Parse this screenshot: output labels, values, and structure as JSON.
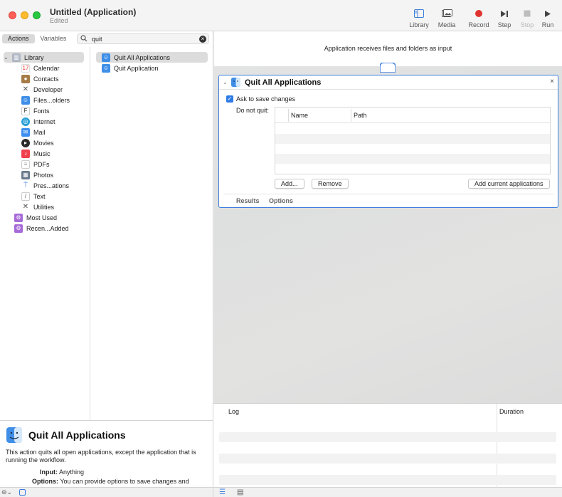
{
  "window": {
    "title": "Untitled (Application)",
    "subtitle": "Edited"
  },
  "toolbar": {
    "library_label": "Library",
    "media_label": "Media",
    "record_label": "Record",
    "step_label": "Step",
    "stop_label": "Stop",
    "run_label": "Run",
    "record_color": "#e0332e"
  },
  "sidebar": {
    "tabs": [
      "Actions",
      "Variables"
    ],
    "search": {
      "value": "quit"
    },
    "library": [
      {
        "label": "Library",
        "icon": "library-icon"
      },
      {
        "label": "Calendar",
        "icon": "calendar-icon"
      },
      {
        "label": "Contacts",
        "icon": "contacts-icon"
      },
      {
        "label": "Developer",
        "icon": "developer-icon"
      },
      {
        "label": "Files...olders",
        "icon": "finder-icon"
      },
      {
        "label": "Fonts",
        "icon": "fonts-icon"
      },
      {
        "label": "Internet",
        "icon": "internet-icon"
      },
      {
        "label": "Mail",
        "icon": "mail-icon"
      },
      {
        "label": "Movies",
        "icon": "movies-icon"
      },
      {
        "label": "Music",
        "icon": "music-icon"
      },
      {
        "label": "PDFs",
        "icon": "pdf-icon"
      },
      {
        "label": "Photos",
        "icon": "photos-icon"
      },
      {
        "label": "Pres...ations",
        "icon": "presentations-icon"
      },
      {
        "label": "Text",
        "icon": "text-icon"
      },
      {
        "label": "Utilities",
        "icon": "utilities-icon"
      },
      {
        "label": "Most Used",
        "icon": "smart-folder-icon"
      },
      {
        "label": "Recen...Added",
        "icon": "smart-folder-icon"
      }
    ],
    "actions": [
      "Quit All Applications",
      "Quit Application"
    ]
  },
  "description": {
    "title": "Quit All Applications",
    "text": "This action quits all open applications, except the application that is running the workflow.",
    "input_key": "Input:",
    "input_val": "Anything",
    "options_key": "Options:",
    "options_val": "You can provide options to save changes and"
  },
  "workflow": {
    "header": "Application receives files and folders as input",
    "action": {
      "title": "Quit All Applications",
      "checkbox_label": "Ask to save changes",
      "checkbox_checked": true,
      "do_not_quit_label": "Do not quit:",
      "columns": [
        "Name",
        "Path"
      ],
      "add_label": "Add...",
      "remove_label": "Remove",
      "add_current_label": "Add current applications",
      "footer_tabs": [
        "Results",
        "Options"
      ],
      "close_glyph": "×"
    }
  },
  "log": {
    "columns": [
      "Log",
      "Duration"
    ]
  }
}
